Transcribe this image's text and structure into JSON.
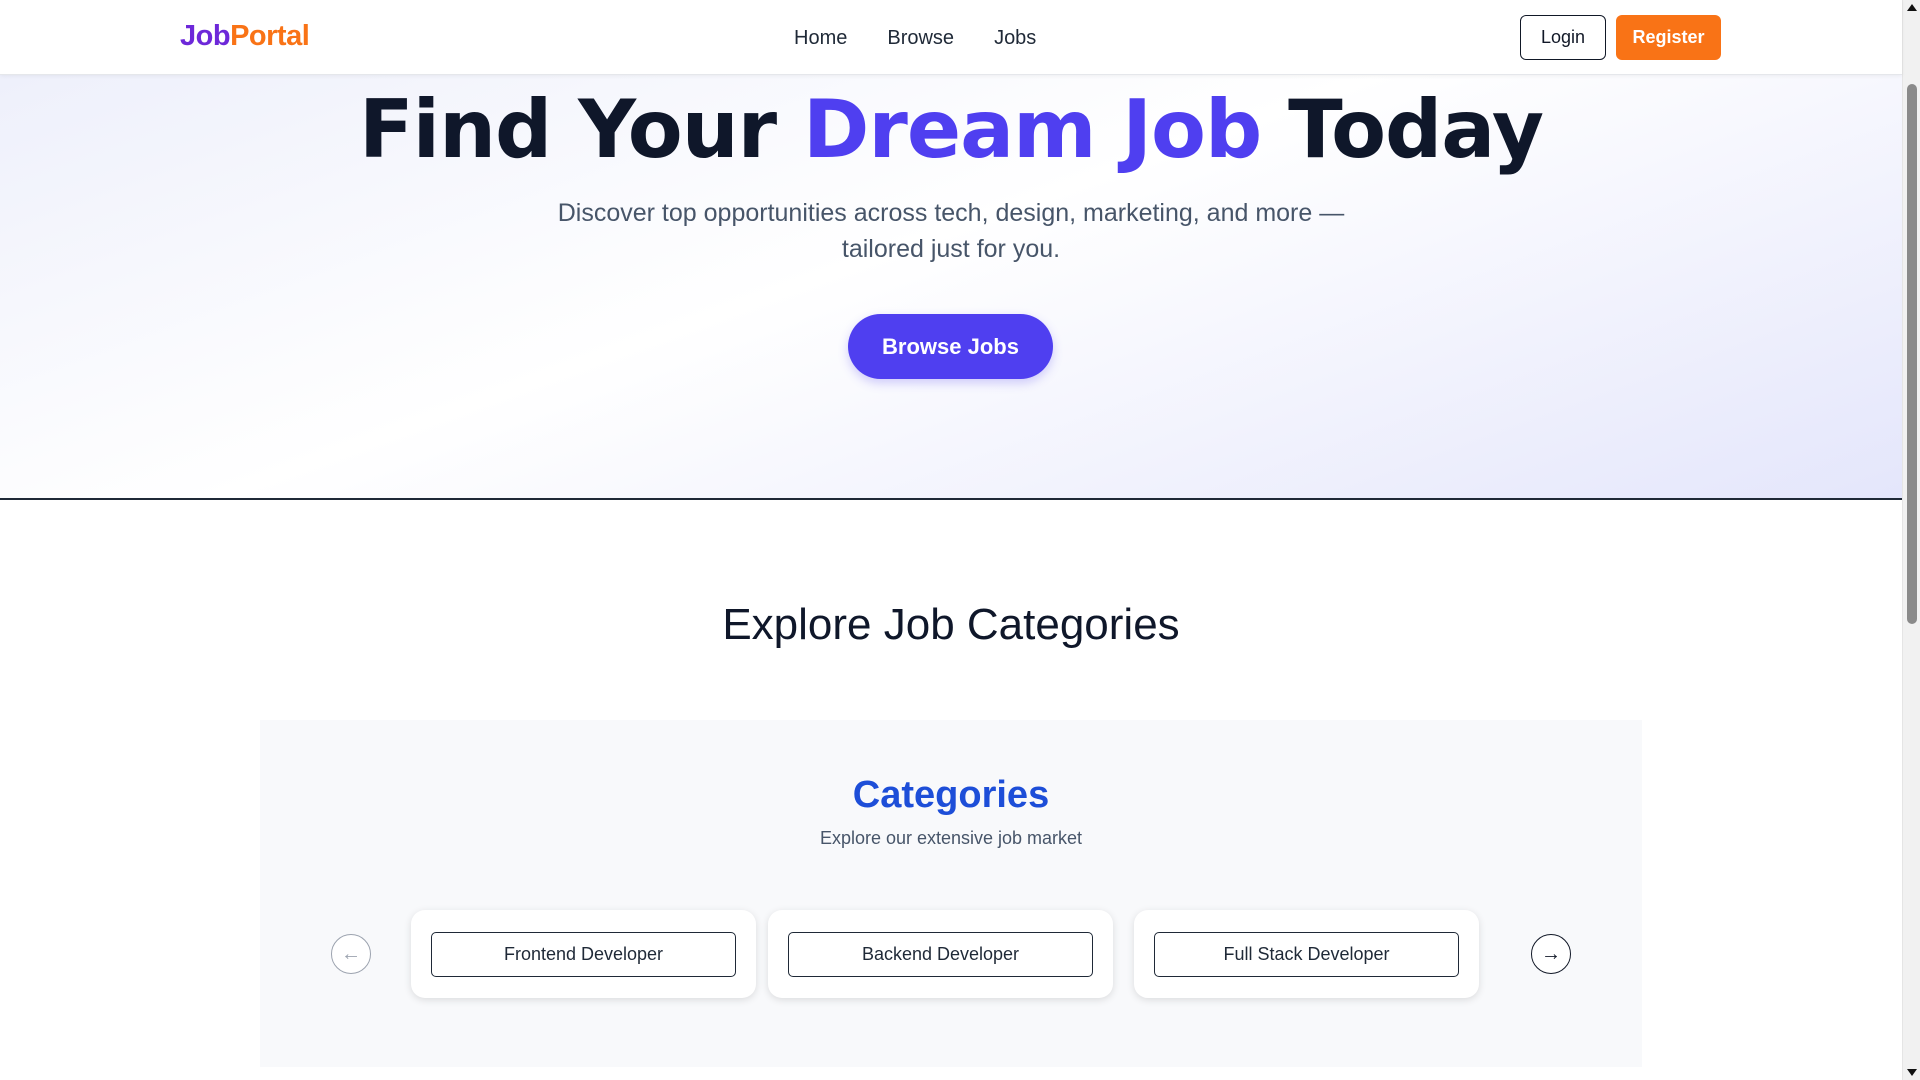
{
  "navbar": {
    "brand_part1": "Job",
    "brand_part2": "Portal",
    "links": [
      "Home",
      "Browse",
      "Jobs"
    ],
    "login_label": "Login",
    "register_label": "Register"
  },
  "hero": {
    "title_pre": "Find Your ",
    "title_accent": "Dream Job",
    "title_post": " Today",
    "subtitle": "Discover top opportunities across tech, design, marketing, and more — tailored just for you.",
    "cta_label": "Browse Jobs"
  },
  "explore": {
    "title": "Explore Job Categories"
  },
  "categories": {
    "title": "Categories",
    "subtitle": "Explore our extensive job market",
    "prev_icon": "←",
    "next_icon": "→",
    "items": [
      "Frontend Developer",
      "Backend Developer",
      "Full Stack Developer"
    ]
  },
  "colors": {
    "brand_purple": "#6d28d9",
    "brand_orange": "#f97316",
    "accent": "#4f3ff0",
    "categories_title": "#1d4ed8"
  }
}
